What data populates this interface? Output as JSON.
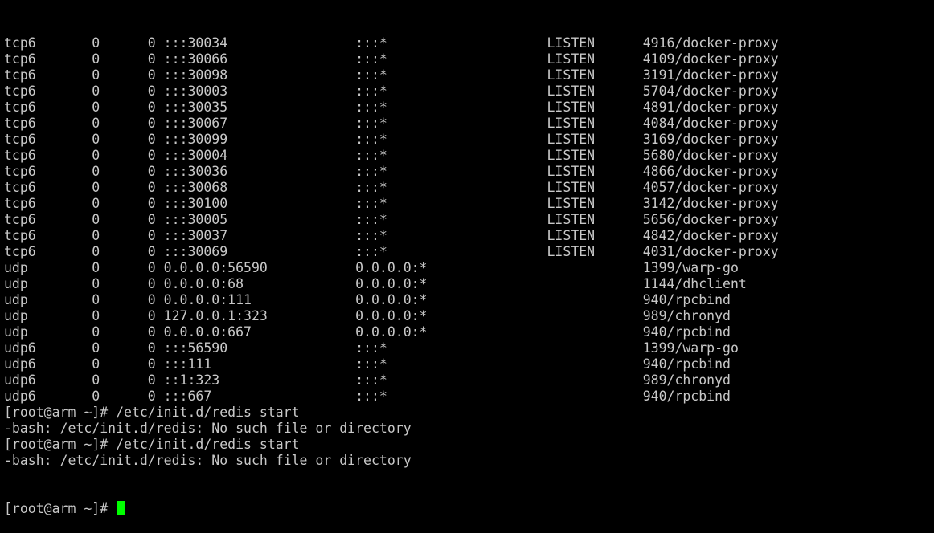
{
  "colors": {
    "background": "#000000",
    "text": "#c8c8c8",
    "cursor": "#00ff00"
  },
  "terminal": {
    "lines": [
      "tcp6       0      0 :::30034                :::*                    LISTEN      4916/docker-proxy",
      "tcp6       0      0 :::30066                :::*                    LISTEN      4109/docker-proxy",
      "tcp6       0      0 :::30098                :::*                    LISTEN      3191/docker-proxy",
      "tcp6       0      0 :::30003                :::*                    LISTEN      5704/docker-proxy",
      "tcp6       0      0 :::30035                :::*                    LISTEN      4891/docker-proxy",
      "tcp6       0      0 :::30067                :::*                    LISTEN      4084/docker-proxy",
      "tcp6       0      0 :::30099                :::*                    LISTEN      3169/docker-proxy",
      "tcp6       0      0 :::30004                :::*                    LISTEN      5680/docker-proxy",
      "tcp6       0      0 :::30036                :::*                    LISTEN      4866/docker-proxy",
      "tcp6       0      0 :::30068                :::*                    LISTEN      4057/docker-proxy",
      "tcp6       0      0 :::30100                :::*                    LISTEN      3142/docker-proxy",
      "tcp6       0      0 :::30005                :::*                    LISTEN      5656/docker-proxy",
      "tcp6       0      0 :::30037                :::*                    LISTEN      4842/docker-proxy",
      "tcp6       0      0 :::30069                :::*                    LISTEN      4031/docker-proxy",
      "udp        0      0 0.0.0.0:56590           0.0.0.0:*                           1399/warp-go",
      "udp        0      0 0.0.0.0:68              0.0.0.0:*                           1144/dhclient",
      "udp        0      0 0.0.0.0:111             0.0.0.0:*                           940/rpcbind",
      "udp        0      0 127.0.0.1:323           0.0.0.0:*                           989/chronyd",
      "udp        0      0 0.0.0.0:667             0.0.0.0:*                           940/rpcbind",
      "udp6       0      0 :::56590                :::*                                1399/warp-go",
      "udp6       0      0 :::111                  :::*                                940/rpcbind",
      "udp6       0      0 ::1:323                 :::*                                989/chronyd",
      "udp6       0      0 :::667                  :::*                                940/rpcbind",
      "[root@arm ~]# /etc/init.d/redis start",
      "-bash: /etc/init.d/redis: No such file or directory",
      "[root@arm ~]# /etc/init.d/redis start",
      "-bash: /etc/init.d/redis: No such file or directory"
    ],
    "prompt": "[root@arm ~]# "
  }
}
